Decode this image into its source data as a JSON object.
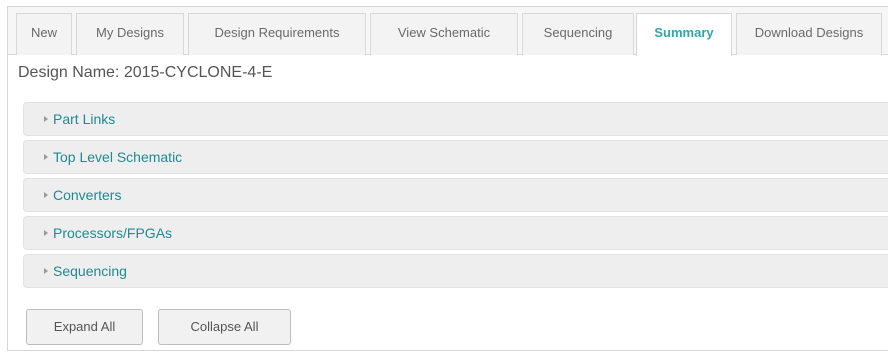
{
  "tabs": [
    {
      "label": "New",
      "active": false
    },
    {
      "label": "My Designs",
      "active": false
    },
    {
      "label": "Design Requirements",
      "active": false
    },
    {
      "label": "View Schematic",
      "active": false
    },
    {
      "label": "Sequencing",
      "active": false
    },
    {
      "label": "Summary",
      "active": true
    },
    {
      "label": "Download Designs",
      "active": false
    }
  ],
  "design": {
    "name_text": "Design Name: 2015-CYCLONE-4-E"
  },
  "panels": [
    {
      "label": "Part Links",
      "icon": "caret-right-icon"
    },
    {
      "label": "Top Level Schematic",
      "icon": "caret-right-icon"
    },
    {
      "label": "Converters",
      "icon": "caret-right-icon"
    },
    {
      "label": "Processors/FPGAs",
      "icon": "caret-right-icon"
    },
    {
      "label": "Sequencing",
      "icon": "caret-right-icon"
    }
  ],
  "buttons": {
    "expand_all": "Expand All",
    "collapse_all": "Collapse All"
  },
  "colors": {
    "accent": "#2fa7a7",
    "link": "#1f8a93",
    "panel_bg": "#eeeeee"
  }
}
